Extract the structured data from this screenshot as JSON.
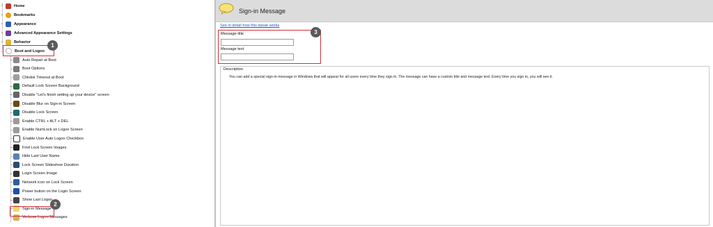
{
  "tree": {
    "top_items": [
      {
        "label": "Home",
        "color": "#c0392b"
      },
      {
        "label": "Bookmarks",
        "color": "#e6a019"
      },
      {
        "label": "Appearance",
        "color": "#2f5fb0"
      },
      {
        "label": "Advanced Appearance Settings",
        "color": "#6b3fa0"
      },
      {
        "label": "Behavior",
        "color": "#e0b33a"
      }
    ],
    "boot_item": {
      "label": "Boot and Logon",
      "icon": "loading-dots-icon"
    },
    "children": [
      {
        "label": "Auto Repair at Boot",
        "icon": "repair-icon"
      },
      {
        "label": "Boot Options",
        "icon": "settings-icon"
      },
      {
        "label": "Chkdsk Timeout at Boot",
        "icon": "disk-icon"
      },
      {
        "label": "Default Lock Screen Background",
        "icon": "image-icon"
      },
      {
        "label": "Disable \"Let's finish setting up your device\" screen",
        "icon": "gear-icon"
      },
      {
        "label": "Disable Blur on Sign-in Screen",
        "icon": "blur-icon"
      },
      {
        "label": "Disable Lock Screen",
        "icon": "lock-screen-icon"
      },
      {
        "label": "Enable CTRL + ALT + DEL",
        "icon": "keyboard-icon"
      },
      {
        "label": "Enable NumLock on Logon Screen",
        "icon": "keyboard-icon"
      },
      {
        "label": "Enable User Auto Logon Checkbox",
        "icon": "checkbox-icon"
      },
      {
        "label": "Find Lock Screen Images",
        "icon": "search-image-icon"
      },
      {
        "label": "Hide Last User Name",
        "icon": "user-icon"
      },
      {
        "label": "Lock Screen Slideshow Duration",
        "icon": "slideshow-icon"
      },
      {
        "label": "Login Screen Image",
        "icon": "person-icon"
      },
      {
        "label": "Network icon on Lock Screen",
        "icon": "network-icon"
      },
      {
        "label": "Power button on the Login Screen",
        "icon": "power-icon"
      },
      {
        "label": "Show Last Logon",
        "icon": "clock-icon"
      },
      {
        "label": "Sign-in Message",
        "icon": "message-bubble-icon"
      },
      {
        "label": "Verbose Logon Messages",
        "icon": "message-icon"
      }
    ]
  },
  "badges": {
    "one": "1",
    "two": "2",
    "three": "3"
  },
  "right": {
    "title": "Sign-in Message",
    "link": "See in detail how this tweak works",
    "message_title_label": "Message title",
    "message_title_value": "",
    "message_text_label": "Message text",
    "message_text_value": "",
    "description_label": "Description",
    "description_text": "You can add a special sign-in message in Windows that will appear for all users every time they sign in. The message can have a custom title and message text. Every time you sign in, you will see it."
  },
  "colors": {
    "highlight": "#d0303a",
    "badge": "#5a5a5a",
    "link": "#1f57c7"
  }
}
